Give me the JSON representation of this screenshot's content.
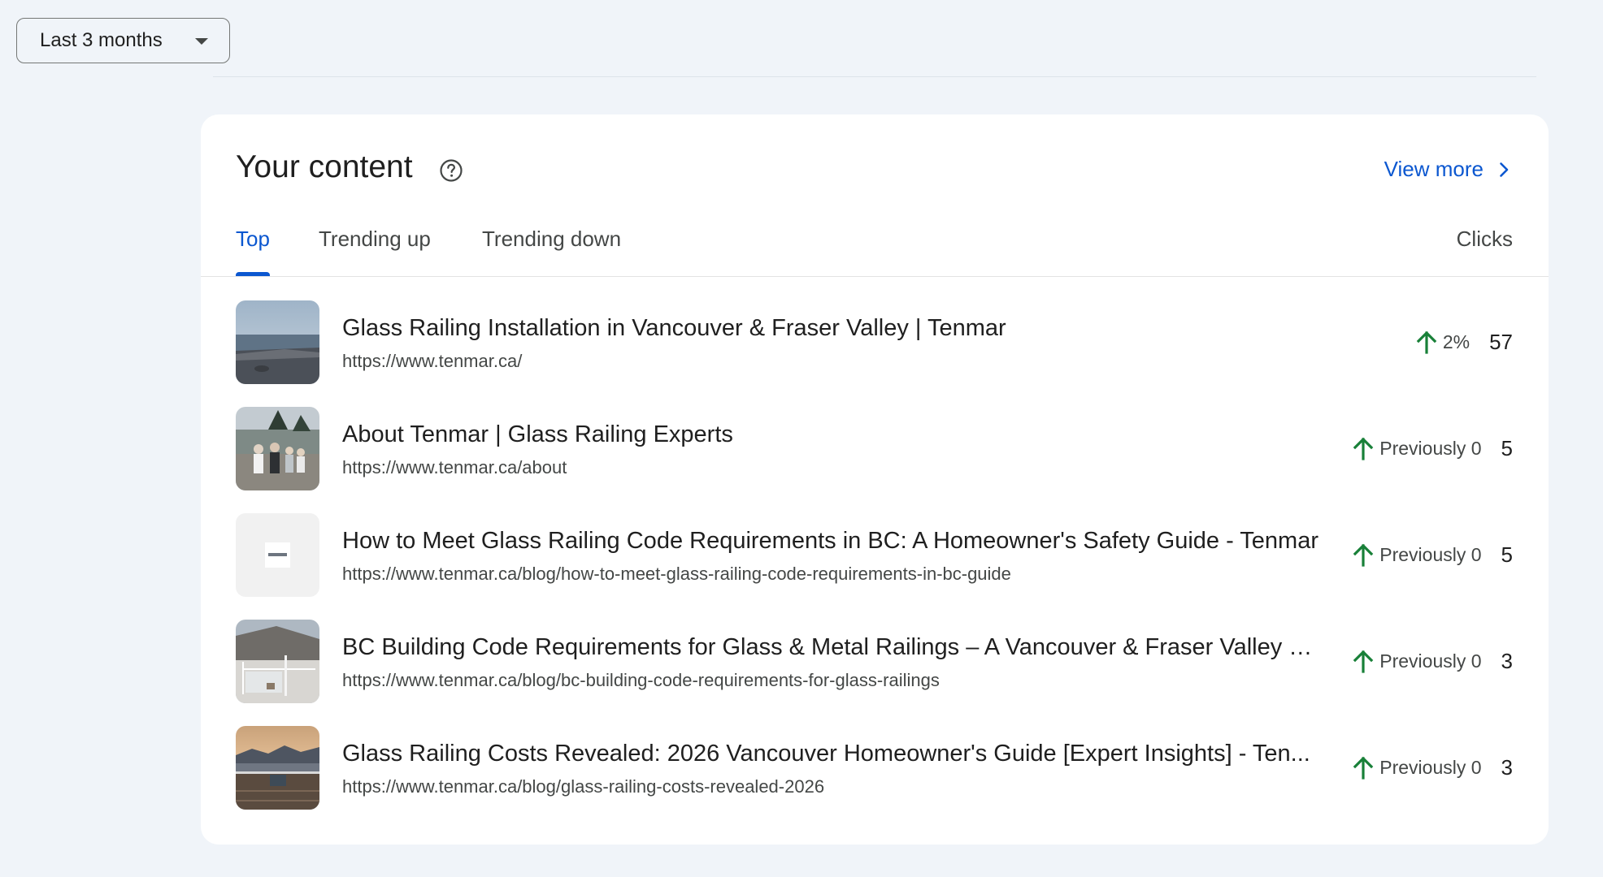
{
  "date_range": {
    "label": "Last 3 months"
  },
  "card": {
    "title": "Your content",
    "view_more": "View more",
    "tabs": [
      {
        "label": "Top",
        "active": true
      },
      {
        "label": "Trending up",
        "active": false
      },
      {
        "label": "Trending down",
        "active": false
      }
    ],
    "column_header": "Clicks",
    "rows": [
      {
        "title": "Glass Railing Installation in Vancouver & Fraser Valley | Tenmar",
        "url": "https://www.tenmar.ca/",
        "trend_icon": "arrow-up-icon",
        "trend": "2%",
        "clicks": "57"
      },
      {
        "title": "About Tenmar | Glass Railing Experts",
        "url": "https://www.tenmar.ca/about",
        "trend_icon": "arrow-up-icon",
        "trend": "Previously 0",
        "clicks": "5"
      },
      {
        "title": "How to Meet Glass Railing Code Requirements in BC: A Homeowner's Safety Guide - Tenmar",
        "url": "https://www.tenmar.ca/blog/how-to-meet-glass-railing-code-requirements-in-bc-guide",
        "trend_icon": "arrow-up-icon",
        "trend": "Previously 0",
        "clicks": "5"
      },
      {
        "title": "BC Building Code Requirements for Glass & Metal Railings – A Vancouver & Fraser Valley G...",
        "url": "https://www.tenmar.ca/blog/bc-building-code-requirements-for-glass-railings",
        "trend_icon": "arrow-up-icon",
        "trend": "Previously 0",
        "clicks": "3"
      },
      {
        "title": "Glass Railing Costs Revealed: 2026 Vancouver Homeowner's Guide [Expert Insights] - Ten...",
        "url": "https://www.tenmar.ca/blog/glass-railing-costs-revealed-2026",
        "trend_icon": "arrow-up-icon",
        "trend": "Previously 0",
        "clicks": "3"
      }
    ]
  },
  "colors": {
    "page_background": "#f0f4f9",
    "accent": "#0b57d0",
    "trend_up": "#188038"
  }
}
